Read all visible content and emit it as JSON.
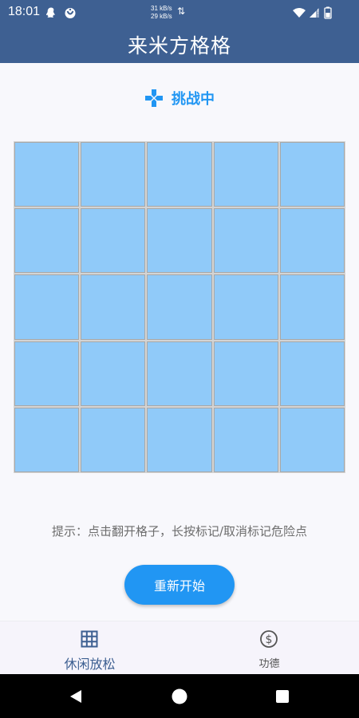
{
  "status_bar": {
    "time": "18:01",
    "net_up": "31 kB/s",
    "net_down": "29 kB/s"
  },
  "app_bar": {
    "title": "来米方格格"
  },
  "game": {
    "status_label": "挑战中",
    "rows": 5,
    "cols": 5,
    "hint": "提示：点击翻开格子，长按标记/取消标记危险点",
    "restart_label": "重新开始"
  },
  "bottom_nav": {
    "items": [
      {
        "label": "休闲放松",
        "icon": "grid-icon",
        "active": true
      },
      {
        "label": "功德",
        "icon": "dollar-circle-icon",
        "active": false
      }
    ]
  },
  "colors": {
    "primary": "#3e6092",
    "accent": "#2196f3",
    "cell": "#90caf9"
  }
}
